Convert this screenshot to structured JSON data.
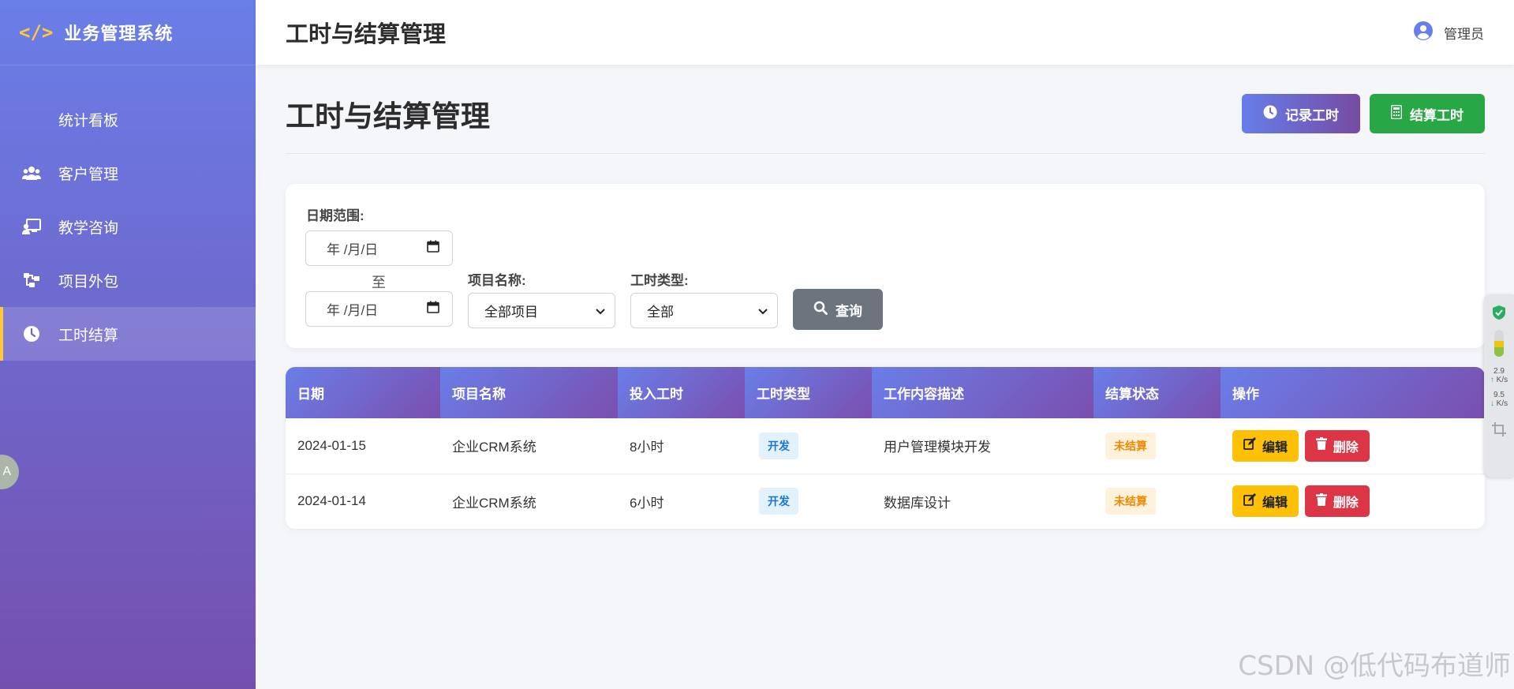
{
  "sidebar": {
    "brand_icon": "</>",
    "brand_title": "业务管理系统",
    "items": [
      {
        "label": "统计看板",
        "icon": "none"
      },
      {
        "label": "客户管理",
        "icon": "users-icon"
      },
      {
        "label": "教学咨询",
        "icon": "teacher-icon"
      },
      {
        "label": "项目外包",
        "icon": "sitemap-icon"
      },
      {
        "label": "工时结算",
        "icon": "clock-icon",
        "active": true
      }
    ]
  },
  "header": {
    "title": "工时与结算管理",
    "user": "管理员"
  },
  "page": {
    "title": "工时与结算管理",
    "record_button": "记录工时",
    "settle_button": "结算工时"
  },
  "filters": {
    "date_label": "日期范围:",
    "date_placeholder": "年 /月/日",
    "to_label": "至",
    "project_label": "项目名称:",
    "project_value": "全部项目",
    "type_label": "工时类型:",
    "type_value": "全部",
    "query_button": "查询"
  },
  "table": {
    "headers": [
      "日期",
      "项目名称",
      "投入工时",
      "工时类型",
      "工作内容描述",
      "结算状态",
      "操作"
    ],
    "rows": [
      {
        "date": "2024-01-15",
        "project": "企业CRM系统",
        "hours": "8小时",
        "type": "开发",
        "desc": "用户管理模块开发",
        "status": "未结算"
      },
      {
        "date": "2024-01-14",
        "project": "企业CRM系统",
        "hours": "6小时",
        "type": "开发",
        "desc": "数据库设计",
        "status": "未结算"
      }
    ],
    "edit_label": "编辑",
    "delete_label": "删除"
  },
  "widgets": {
    "left_float": "A",
    "upload_speed": "2.9",
    "download_speed": "9.5",
    "speed_unit": "K/s"
  },
  "watermark": "CSDN @低代码布道师",
  "colors": {
    "sidebar_top": "#6a7ee8",
    "sidebar_bottom": "#7450ae",
    "accent": "#ffc83d",
    "success": "#28a745",
    "warning": "#ffc107",
    "danger": "#dc3545",
    "secondary": "#6c757d"
  }
}
